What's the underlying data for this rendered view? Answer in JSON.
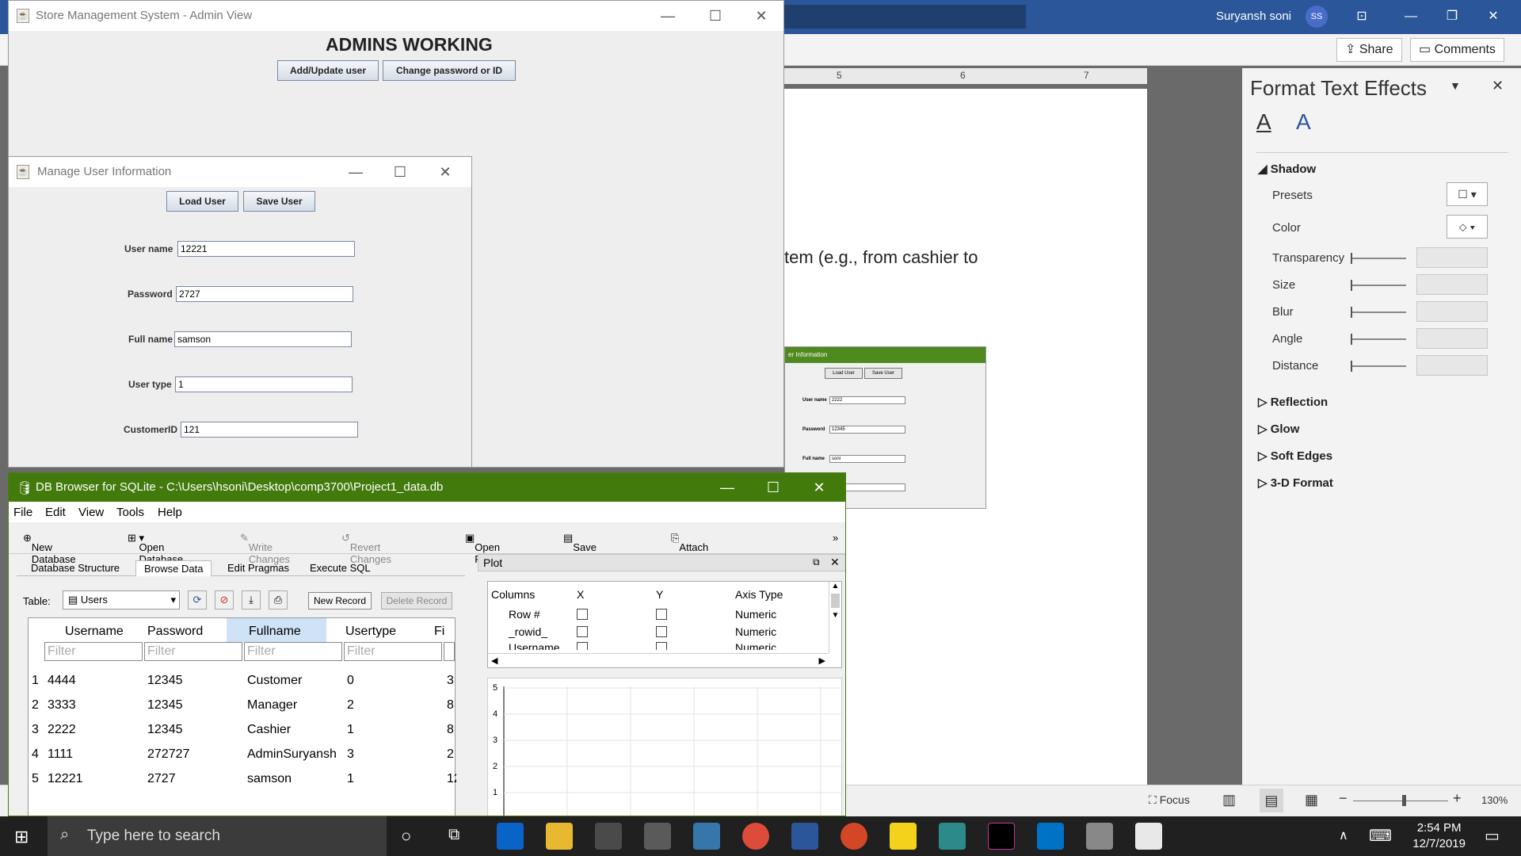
{
  "word": {
    "user_name": "Suryansh soni",
    "avatar_initials": "SS",
    "share_label": "Share",
    "comments_label": "Comments",
    "ruler_marks": [
      "5",
      "6",
      "7"
    ],
    "doc_text": "tem (e.g., from cashier to",
    "thumb": {
      "title": "er Information",
      "load": "Load User",
      "save": "Save User",
      "user_label": "User name",
      "user_val": "2222",
      "pass_label": "Password",
      "pass_val": "12345",
      "full_label": "Full name",
      "full_val": "soni"
    },
    "format_pane": {
      "title": "Format Text Effects",
      "section_shadow": "Shadow",
      "presets": "Presets",
      "color": "Color",
      "transparency": "Transparency",
      "size": "Size",
      "blur": "Blur",
      "angle": "Angle",
      "distance": "Distance",
      "reflection": "Reflection",
      "glow": "Glow",
      "soft_edges": "Soft Edges",
      "format_3d": "3-D Format"
    },
    "status": {
      "focus": "Focus",
      "zoom": "130%"
    }
  },
  "admin": {
    "title": "Store Management System - Admin View",
    "heading": "ADMINS WORKING",
    "btn_add": "Add/Update user",
    "btn_change": "Change password or ID"
  },
  "manage": {
    "title": "Manage User Information",
    "btn_load": "Load User",
    "btn_save": "Save User",
    "user_label": "User name",
    "user_val": "12221",
    "pass_label": "Password",
    "pass_val": "2727",
    "full_label": "Full name",
    "full_val": "samson",
    "type_label": "User type",
    "type_val": "1",
    "cust_label": "CustomerID",
    "cust_val": "121"
  },
  "db": {
    "title": "DB Browser for SQLite - C:\\Users\\hsoni\\Desktop\\comp3700\\Project1_data.db",
    "menu": [
      "File",
      "Edit",
      "View",
      "Tools",
      "Help"
    ],
    "toolbar": [
      "New Database",
      "Open Database",
      "Write Changes",
      "Revert Changes",
      "Open Project",
      "Save Project",
      "Attach Database"
    ],
    "tabs": [
      "Database Structure",
      "Browse Data",
      "Edit Pragmas",
      "Execute SQL"
    ],
    "table_label": "Table:",
    "table_value": "Users",
    "new_record": "New Record",
    "delete_record": "Delete Record",
    "headers": [
      "Username",
      "Password",
      "Fullname",
      "Usertype",
      "Fi"
    ],
    "filter_placeholder": "Filter",
    "rows": [
      [
        "1",
        "4444",
        "12345",
        "Customer",
        "0",
        "3"
      ],
      [
        "2",
        "3333",
        "12345",
        "Manager",
        "2",
        "8"
      ],
      [
        "3",
        "2222",
        "12345",
        "Cashier",
        "1",
        "8"
      ],
      [
        "4",
        "1111",
        "272727",
        "AdminSuryansh",
        "3",
        "2"
      ],
      [
        "5",
        "12221",
        "2727",
        "samson",
        "1",
        "12"
      ]
    ],
    "plot_title": "Plot",
    "plot_cols": [
      "Columns",
      "X",
      "Y",
      "Axis Type"
    ],
    "plot_rows": [
      [
        "Row #",
        "Numeric"
      ],
      [
        "_rowid_",
        "Numeric"
      ],
      [
        "Username",
        "Numeric"
      ]
    ],
    "y_ticks": [
      "5",
      "4",
      "3",
      "2",
      "1"
    ]
  },
  "taskbar": {
    "search_placeholder": "Type here to search",
    "time": "2:54 PM",
    "date": "12/7/2019"
  }
}
